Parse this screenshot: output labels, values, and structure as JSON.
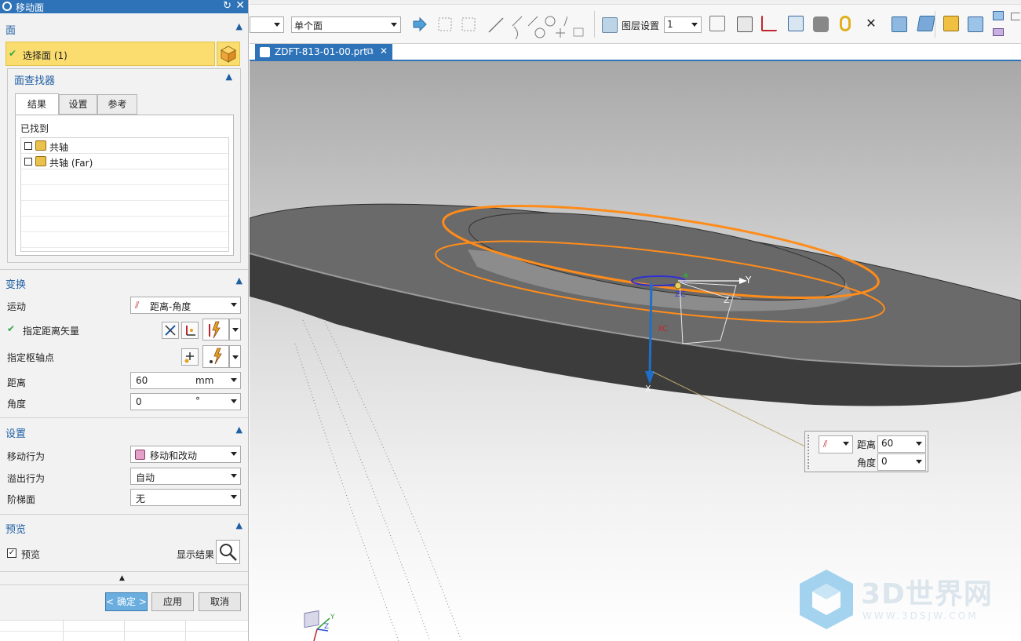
{
  "dialog": {
    "title": "移动面",
    "face_section": {
      "header": "面",
      "select_face": "选择面 (1)",
      "finder": {
        "header": "面查找器",
        "tabs": [
          "结果",
          "设置",
          "参考"
        ],
        "found_label": "已找到",
        "results": [
          "共轴",
          "共轴 (Far)"
        ]
      }
    },
    "transform": {
      "header": "变换",
      "motion_label": "运动",
      "motion_value": "距离-角度",
      "vector_label": "指定距离矢量",
      "pivot_label": "指定枢轴点",
      "distance_label": "距离",
      "distance_value": "60",
      "distance_unit": "mm",
      "angle_label": "角度",
      "angle_value": "0",
      "angle_unit": "°"
    },
    "settings": {
      "header": "设置",
      "move_behavior_label": "移动行为",
      "move_behavior_value": "移动和改动",
      "overflow_label": "溢出行为",
      "overflow_value": "自动",
      "step_face_label": "阶梯面",
      "step_face_value": "无"
    },
    "preview": {
      "header": "预览",
      "preview_label": "预览",
      "show_result_label": "显示结果"
    },
    "buttons": {
      "ok": "< 确定 >",
      "apply": "应用",
      "cancel": "取消"
    }
  },
  "toolbar": {
    "face_filter_value": "单个面",
    "layer_settings_label": "图层设置",
    "layer_value": "1"
  },
  "document_tab": {
    "name": "ZDFT-813-01-00.prt"
  },
  "viewport": {
    "axis_labels": {
      "y": "Y",
      "z": "Z",
      "x": "X",
      "zc": "ZC",
      "xc": "XC",
      "triad_y": "Y",
      "triad_z": "Z"
    }
  },
  "popup": {
    "distance_label": "距离",
    "distance_value": "60",
    "angle_label": "角度",
    "angle_value": "0"
  },
  "watermark": {
    "text": "3D世界网",
    "url": "WWW.3DSJW.COM"
  },
  "colors": {
    "accent": "#2e73b8",
    "selected_row": "#fadd6e",
    "highlight_edge": "#ff8c1a",
    "check": "#2da84a"
  }
}
